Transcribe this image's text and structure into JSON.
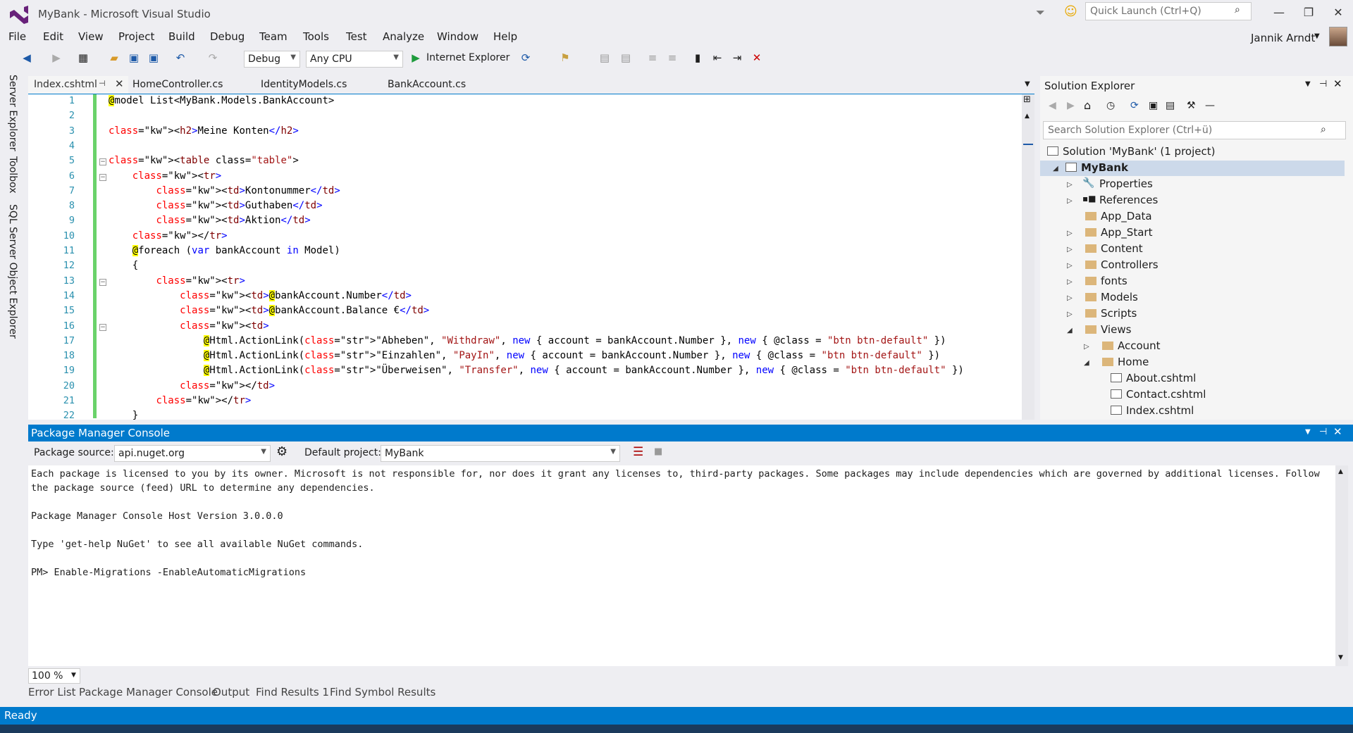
{
  "window": {
    "title": "MyBank - Microsoft Visual Studio",
    "quick_launch_placeholder": "Quick Launch (Ctrl+Q)",
    "user": "Jannik Arndt"
  },
  "menu": [
    "File",
    "Edit",
    "View",
    "Project",
    "Build",
    "Debug",
    "Team",
    "Tools",
    "Test",
    "Analyze",
    "Window",
    "Help"
  ],
  "toolbar": {
    "config": "Debug",
    "platform": "Any CPU",
    "run_target": "Internet Explorer"
  },
  "side_tabs": [
    "Server Explorer",
    "Toolbox",
    "SQL Server Object Explorer"
  ],
  "doc_tabs": [
    "Index.cshtml",
    "HomeController.cs",
    "IdentityModels.cs",
    "BankAccount.cs"
  ],
  "code_lines": [
    "@model List<MyBank.Models.BankAccount>",
    "",
    "<h2>Meine Konten</h2>",
    "",
    "<table class=\"table\">",
    "    <tr>",
    "        <td>Kontonummer</td>",
    "        <td>Guthaben</td>",
    "        <td>Aktion</td>",
    "    </tr>",
    "    @foreach (var bankAccount in Model)",
    "    {",
    "        <tr>",
    "            <td>@bankAccount.Number</td>",
    "            <td>@bankAccount.Balance €</td>",
    "            <td>",
    "                @Html.ActionLink(\"Abheben\", \"Withdraw\", new { account = bankAccount.Number }, new { @class = \"btn btn-default\" })",
    "                @Html.ActionLink(\"Einzahlen\", \"PayIn\", new { account = bankAccount.Number }, new { @class = \"btn btn-default\" })",
    "                @Html.ActionLink(\"Überweisen\", \"Transfer\", new { account = bankAccount.Number }, new { @class = \"btn btn-default\" })",
    "            </td>",
    "        </tr>",
    "    }"
  ],
  "solution_explorer": {
    "title": "Solution Explorer",
    "search_placeholder": "Search Solution Explorer (Ctrl+ü)",
    "items": [
      "Solution 'MyBank' (1 project)",
      "MyBank",
      "Properties",
      "References",
      "App_Data",
      "App_Start",
      "Content",
      "Controllers",
      "fonts",
      "Models",
      "Scripts",
      "Views",
      "Account",
      "Home",
      "About.cshtml",
      "Contact.cshtml",
      "Index.cshtml"
    ]
  },
  "pmc": {
    "title": "Package Manager Console",
    "source_label": "Package source:",
    "source_value": "api.nuget.org",
    "project_label": "Default project:",
    "project_value": "MyBank",
    "output": "Each package is licensed to you by its owner. Microsoft is not responsible for, nor does it grant any licenses to, third-party packages. Some packages may include dependencies which are governed by additional licenses. Follow the package source (feed) URL to determine any dependencies.\n\nPackage Manager Console Host Version 3.0.0.0\n\nType 'get-help NuGet' to see all available NuGet commands.\n\nPM> Enable-Migrations -EnableAutomaticMigrations",
    "zoom": "100 %"
  },
  "bottom_tabs": [
    "Error List",
    "Package Manager Console",
    "Output",
    "Find Results 1",
    "Find Symbol Results"
  ],
  "status": "Ready"
}
